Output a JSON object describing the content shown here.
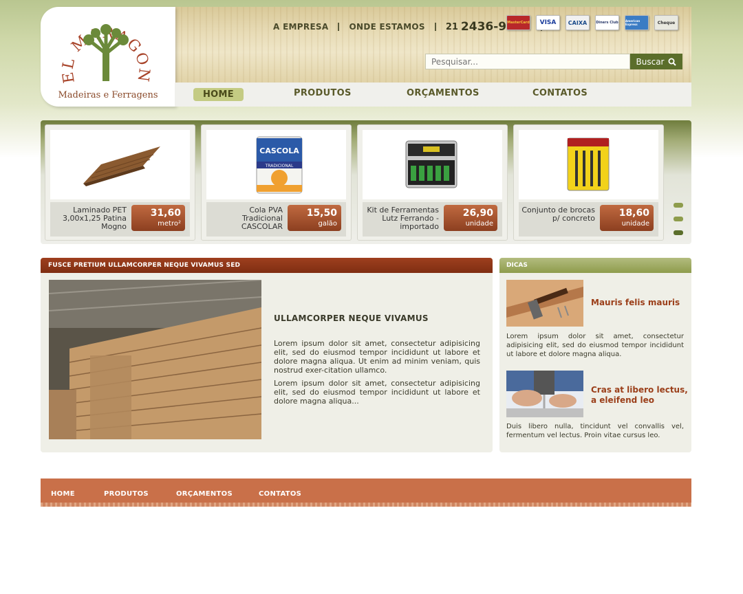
{
  "header": {
    "logo_name": "EL MARAGON",
    "logo_tagline": "Madeiras e Ferragens",
    "top_links": [
      "A EMPRESA",
      "ONDE ESTAMOS"
    ],
    "phone_area": "21",
    "phone_number": "2436-9611",
    "payment_cards": [
      "MasterCard",
      "VISA",
      "CAIXA",
      "Diners Club",
      "American Express",
      "Cheque"
    ],
    "search_placeholder": "Pesquisar...",
    "search_button": "Buscar"
  },
  "nav": [
    "HOME",
    "PRODUTOS",
    "ORÇAMENTOS",
    "CONTATOS"
  ],
  "products": [
    {
      "name": "Laminado PET 3,00x1,25 Patina Mogno",
      "price": "31,60",
      "unit": "metro²"
    },
    {
      "name": "Cola PVA Tradicional CASCOLAR",
      "price": "15,50",
      "unit": "galão"
    },
    {
      "name": "Kit de Ferramentas Lutz Ferrando - importado",
      "price": "26,90",
      "unit": "unidade"
    },
    {
      "name": "Conjunto de brocas p/ concreto",
      "price": "18,60",
      "unit": "unidade"
    }
  ],
  "cascola_label": "CASCOLA",
  "cascola_sub": "TRADICIONAL",
  "main": {
    "header": "FUSCE PRETIUM ULLAMCORPER NEQUE VIVAMUS SED",
    "title": "ULLAMCORPER NEQUE VIVAMUS",
    "paragraph1": "Lorem ipsum dolor sit amet, consectetur adipisicing elit, sed do eiusmod tempor incididunt ut labore et dolore magna aliqua. Ut enim ad minim veniam, quis nostrud exer-citation ullamco.",
    "paragraph2": "Lorem ipsum dolor sit amet, consectetur adipisicing elit, sed do eiusmod tempor incididunt ut labore et dolore magna aliqua..."
  },
  "sidebar": {
    "header": "DICAS",
    "tips": [
      {
        "title": "Mauris felis mauris",
        "text": "Lorem ipsum dolor sit amet, consectetur adipisicing elit, sed do eiusmod tempor incididunt ut labore et dolore magna aliqua."
      },
      {
        "title_line1": "Cras at libero lectus,",
        "title_line2": "a eleifend leo",
        "text": "Duis libero nulla, tincidunt vel convallis vel, fermentum vel lectus. Proin vitae cursus leo."
      }
    ]
  },
  "footer_nav": [
    "HOME",
    "PRODUTOS",
    "ORÇAMENTOS",
    "CONTATOS"
  ],
  "colors": {
    "brand_green": "#5b6e2b",
    "brand_brown": "#8c3f20",
    "footer": "#c97049"
  }
}
